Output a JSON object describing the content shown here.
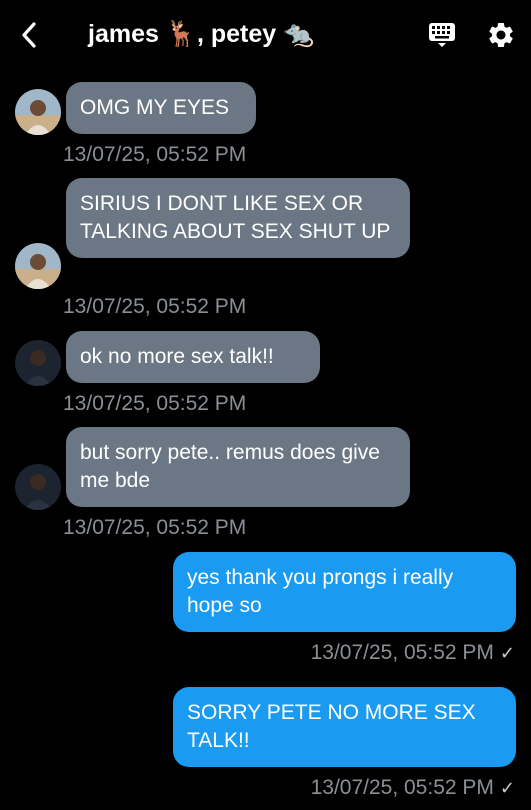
{
  "header": {
    "title": "james 🦌, petey 🐀",
    "back_icon": "chevron-left-icon",
    "keyboard_icon": "keyboard-icon",
    "settings_icon": "gear-icon"
  },
  "colors": {
    "background": "#000000",
    "incoming_bubble": "#6b7785",
    "outgoing_bubble": "#1a9af0",
    "timestamp": "#8a8f96"
  },
  "messages": [
    {
      "direction": "incoming",
      "sender_avatar": "james",
      "text": "OMG MY EYES",
      "timestamp": "13/07/25, 05:52 PM"
    },
    {
      "direction": "incoming",
      "sender_avatar": "james",
      "text": "SIRIUS I DONT LIKE SEX OR TALKING ABOUT SEX SHUT UP",
      "timestamp": "13/07/25, 05:52 PM"
    },
    {
      "direction": "incoming",
      "sender_avatar": "petey",
      "text": "ok no more sex talk!!",
      "timestamp": "13/07/25, 05:52 PM"
    },
    {
      "direction": "incoming",
      "sender_avatar": "petey",
      "text": "but sorry pete.. remus does give me bde",
      "timestamp": "13/07/25, 05:52 PM"
    },
    {
      "direction": "outgoing",
      "text": "yes thank you prongs i really hope so",
      "timestamp": "13/07/25, 05:52 PM",
      "status": "✓"
    },
    {
      "direction": "outgoing",
      "text": "SORRY PETE NO MORE SEX TALK!!",
      "timestamp": "13/07/25, 05:52 PM",
      "status": "✓"
    }
  ]
}
